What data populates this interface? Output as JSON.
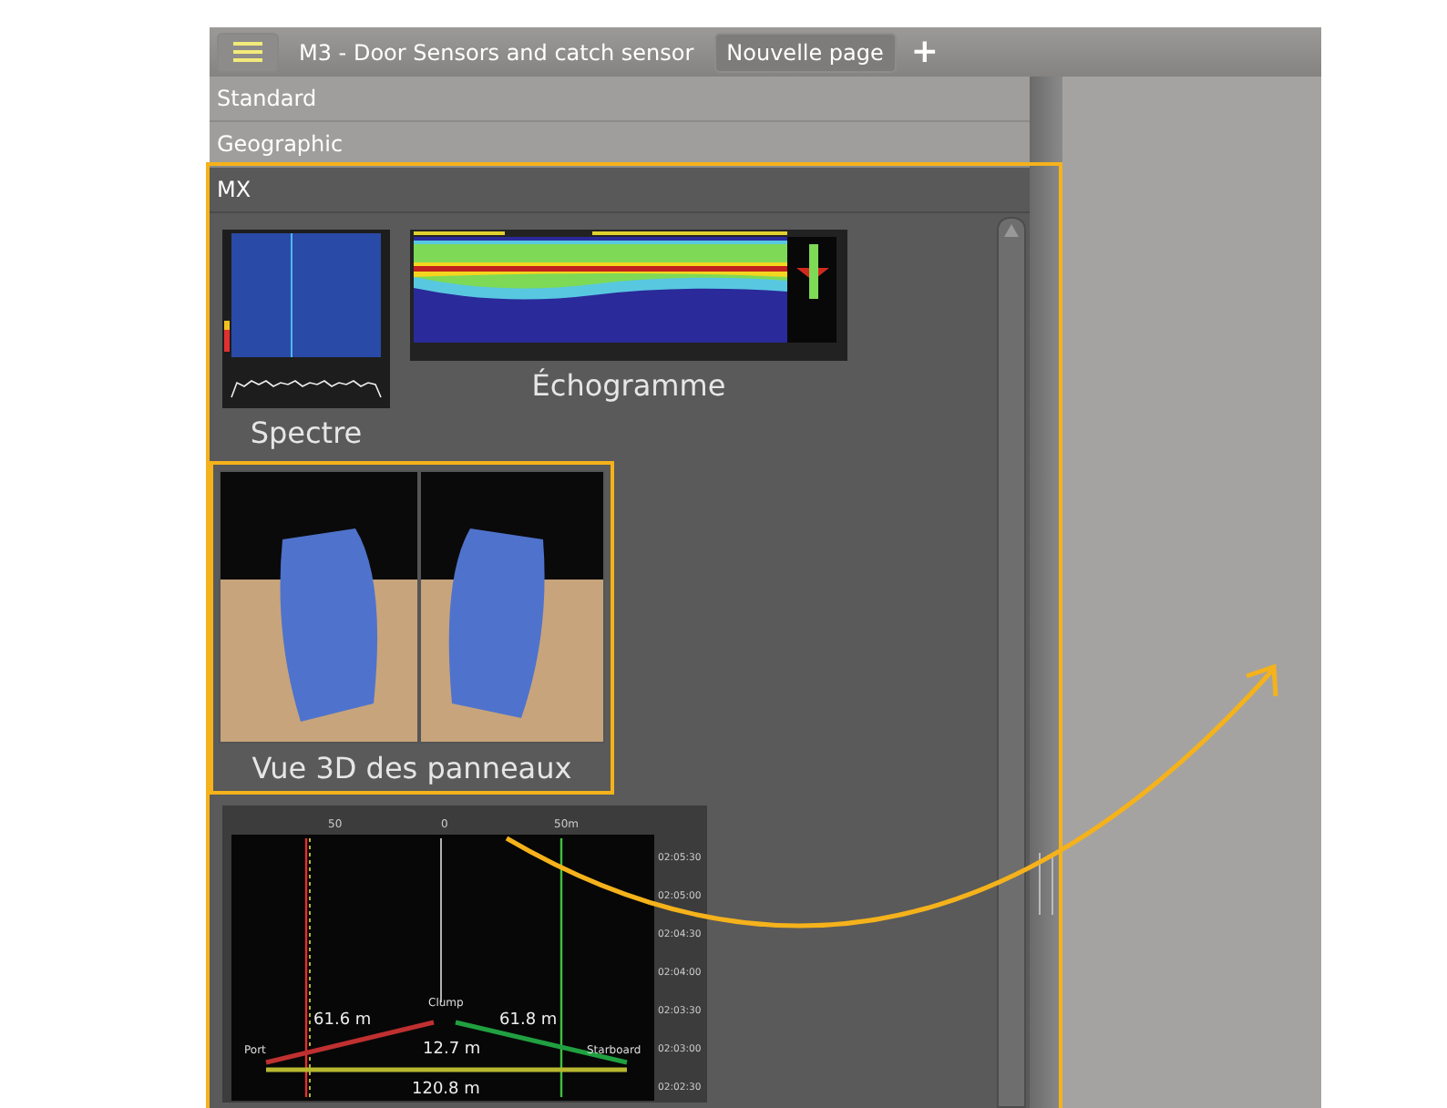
{
  "tabs": [
    {
      "label": "M3 - Door Sensors and catch sensor",
      "selected": false
    },
    {
      "label": "Nouvelle page",
      "selected": true
    }
  ],
  "add_tab": "+",
  "categories": [
    {
      "label": "Standard",
      "selected": false
    },
    {
      "label": "Geographic",
      "selected": false
    },
    {
      "label": "MX",
      "selected": true
    }
  ],
  "views": [
    {
      "kind": "spectrum",
      "label": "Spectre",
      "highlighted": false
    },
    {
      "kind": "echogram",
      "label": "Échogramme",
      "highlighted": false
    },
    {
      "kind": "panels3d",
      "label": "Vue 3D des panneaux",
      "highlighted": true
    },
    {
      "kind": "trawl",
      "highlighted": false,
      "top_ticks": [
        "50",
        "0",
        "50m"
      ],
      "times": [
        "02:05:30",
        "02:05:00",
        "02:04:30",
        "02:04:00",
        "02:03:30",
        "02:03:00",
        "02:02:30"
      ],
      "port": "Port",
      "starboard": "Starboard",
      "clump": "Clump",
      "port_distance": "61.6 m",
      "clump_distance": "12.7 m",
      "starboard_distance": "61.8 m",
      "spread": "120.8 m"
    }
  ]
}
